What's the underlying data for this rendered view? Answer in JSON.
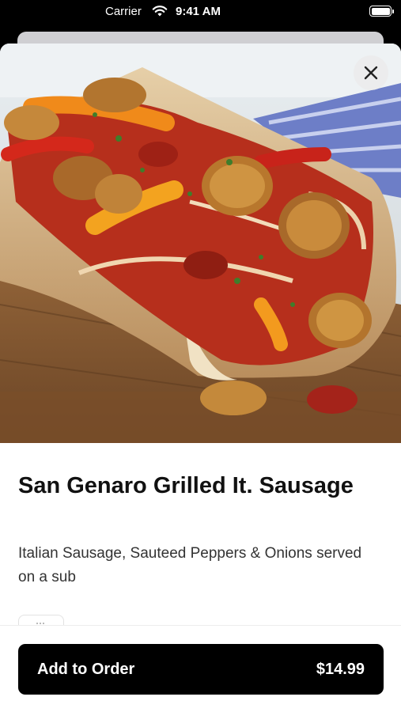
{
  "status_bar": {
    "carrier": "Carrier",
    "time": "9:41 AM",
    "icons": [
      "wifi-icon",
      "battery-icon"
    ]
  },
  "item": {
    "image_description_icon": "food-photo",
    "title": "San Genaro Grilled It. Sausage",
    "description": "Italian Sausage, Sauteed Peppers & Onions served on a sub"
  },
  "close_icon": "close-icon",
  "footer": {
    "button_label": "Add to Order",
    "price": "$14.99"
  },
  "colors": {
    "button_bg": "#000000",
    "button_text": "#ffffff",
    "sheet_bg": "#ffffff"
  }
}
